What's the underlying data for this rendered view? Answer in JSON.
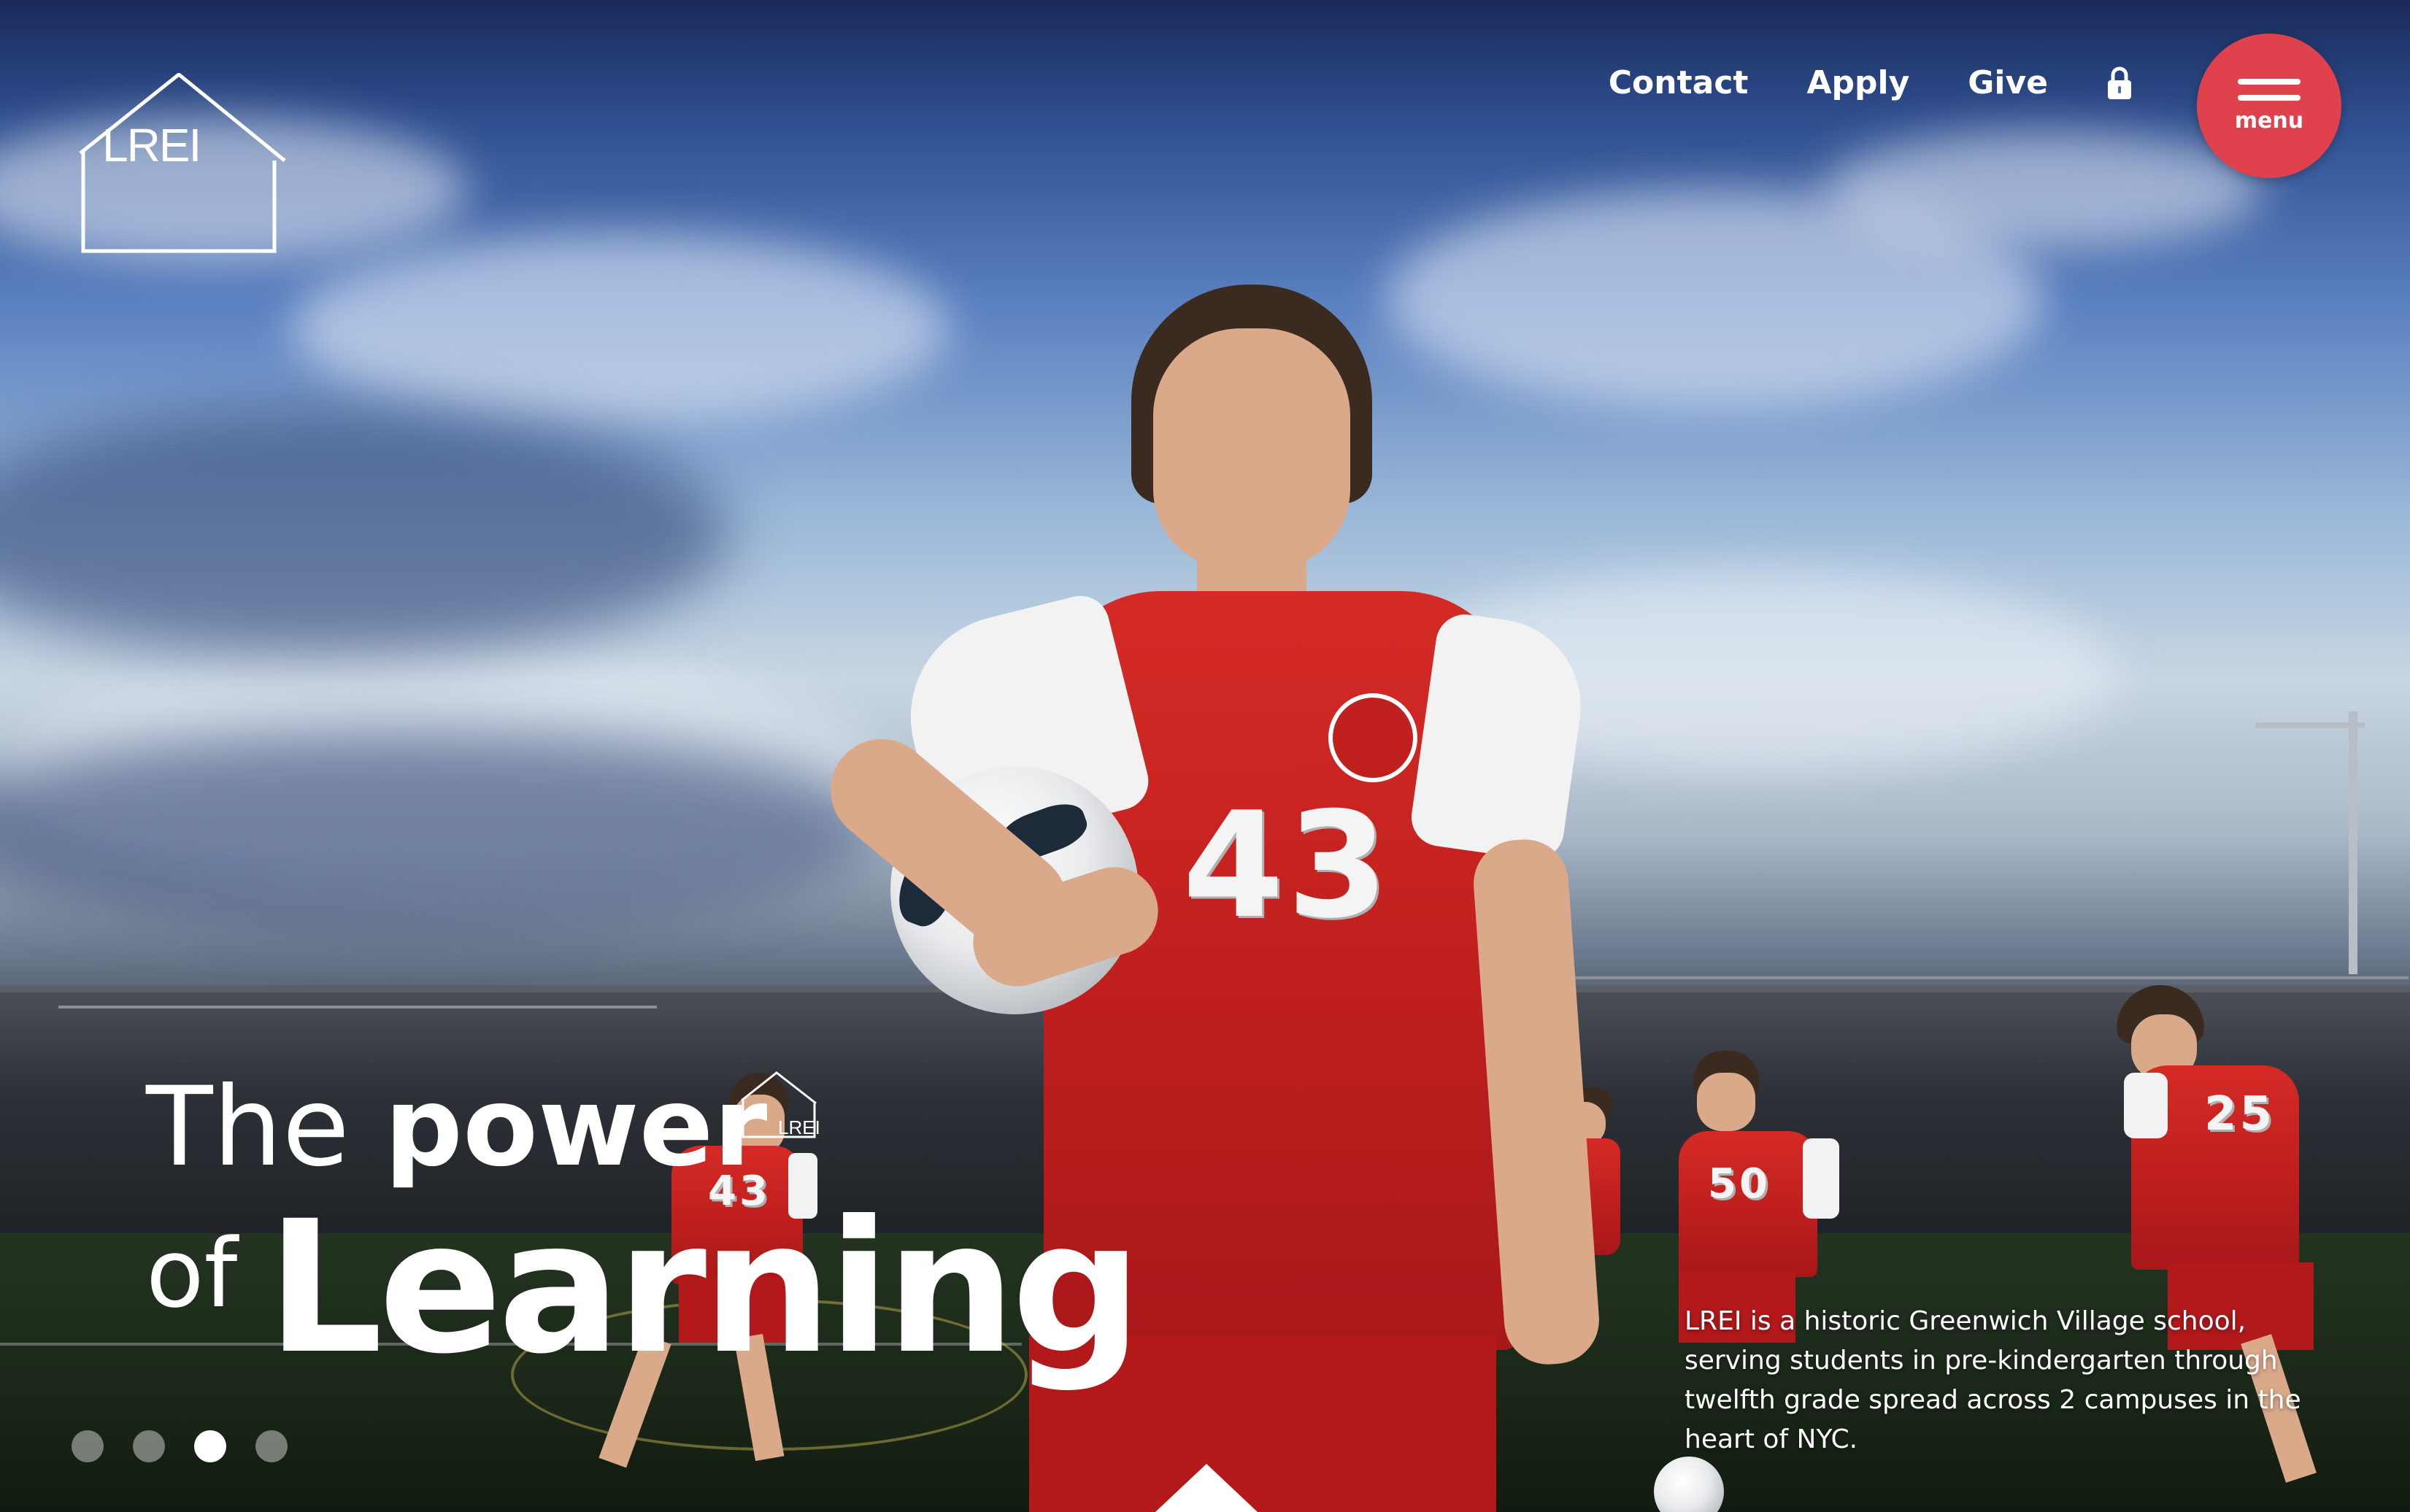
{
  "brand": {
    "logo_text": "LREI",
    "mini_logo_text": "LREI"
  },
  "nav": {
    "links": [
      {
        "label": "Contact"
      },
      {
        "label": "Apply"
      },
      {
        "label": "Give"
      }
    ],
    "lock_icon": "lock-icon"
  },
  "menu": {
    "label": "menu",
    "icon": "hamburger-icon",
    "color": "#e0424d"
  },
  "hero": {
    "headline_part1": "The",
    "headline_part2": "power",
    "headline_part3": "of",
    "headline_part4": "Learning",
    "description": "LREI is a historic Greenwich Village school, serving students in pre-kindergarten through twelfth grade spread across 2 campuses in the heart of NYC.",
    "jersey_number": "43",
    "bg_player_numbers": [
      "43",
      "50",
      "25"
    ]
  },
  "carousel": {
    "slide_count": 4,
    "active_index": 2
  },
  "scroll_indicator": {
    "icon": "caret-up-icon"
  }
}
